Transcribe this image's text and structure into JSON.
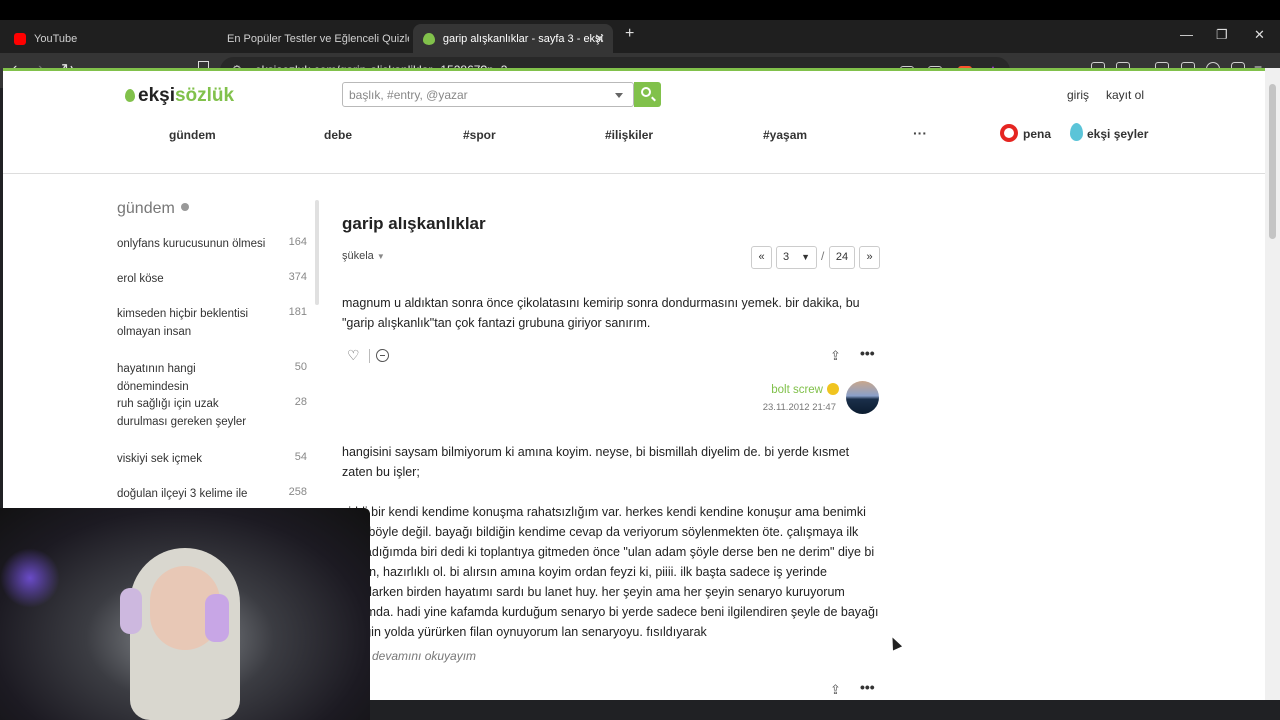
{
  "browser": {
    "tabs": [
      {
        "label": "YouTube",
        "active": false
      },
      {
        "label": "En Popüler Testler ve Eğlenceli Quizle",
        "active": false
      },
      {
        "label": "garip alışkanlıklar - sayfa 3 - ekşi",
        "active": true
      }
    ],
    "url": "eksisozluk.com/garip-aliskanliklar--152867?p=3"
  },
  "site": {
    "logo_prefix": "ekşi",
    "logo_suffix": "sözlük",
    "search_placeholder": "başlık, #entry, @yazar",
    "login": "giriş",
    "register": "kayıt ol",
    "nav": [
      "gündem",
      "debe",
      "#spor",
      "#ilişkiler",
      "#yaşam",
      "···"
    ],
    "pena": "pena",
    "eksi_seyler": "ekşi şeyler",
    "accent_color": "#81c14b"
  },
  "sidebar": {
    "title": "gündem",
    "items": [
      {
        "label": "onlyfans kurucusunun ölmesi",
        "count": "164"
      },
      {
        "label": "erol köse",
        "count": "374"
      },
      {
        "label": "kimseden hiçbir beklentisi olmayan insan",
        "count": "181"
      },
      {
        "label": "hayatının hangi dönemindesin",
        "count": "50"
      },
      {
        "label": "ruh sağlığı için uzak durulması gereken şeyler",
        "count": "28"
      },
      {
        "label": "viskiyi sek içmek",
        "count": "54"
      },
      {
        "label": "doğulan ilçeyi 3 kelime ile",
        "count": "258"
      }
    ]
  },
  "topic": {
    "title": "garip alışkanlıklar",
    "sort": "şükela",
    "pager": {
      "prev": "«",
      "current": "3",
      "sep": "/",
      "total": "24",
      "next": "»"
    }
  },
  "entries": [
    {
      "text": "magnum u aldıktan sonra önce çikolatasını kemirip sonra dondurmasını yemek. bir dakika, bu \"garip alışkanlık\"tan çok fantazi grubuna giriyor sanırım.",
      "author": "bolt screw",
      "date": "23.11.2012 21:47"
    },
    {
      "text_1": "hangisini saysam bilmiyorum ki amına koyim. neyse, bi bismillah diyelim de. bi yerde kısmet zaten bu işler;",
      "text_2": "ciddi bir kendi kendime konuşma rahatsızlığım var. herkes kendi kendine konuşur ama benimki öyle böyle değil. bayağı bildiğin kendime cevap da veriyorum söylenmekten öte. çalışmaya ilk başladığımda biri dedi ki toplantıya gitmeden önce \"ulan adam şöyle derse ben ne derim\" diye bi düşün, hazırlıklı ol. bi alırsın amına koyim ordan feyzi ki, piiii. ilk başta sadece iş yerinde uygularken birden hayatımı sardı bu lanet huy. her şeyin ama her şeyin senaryo kuruyorum kafamda. hadi yine kafamda kurduğum senaryo bi yerde sadece beni ilgilendiren şeyle de bayağı bildiğin yolda yürürken filan oynuyorum lan senaryoyu. fısıldıyarak",
      "more": "devamını okuyayım"
    }
  ]
}
